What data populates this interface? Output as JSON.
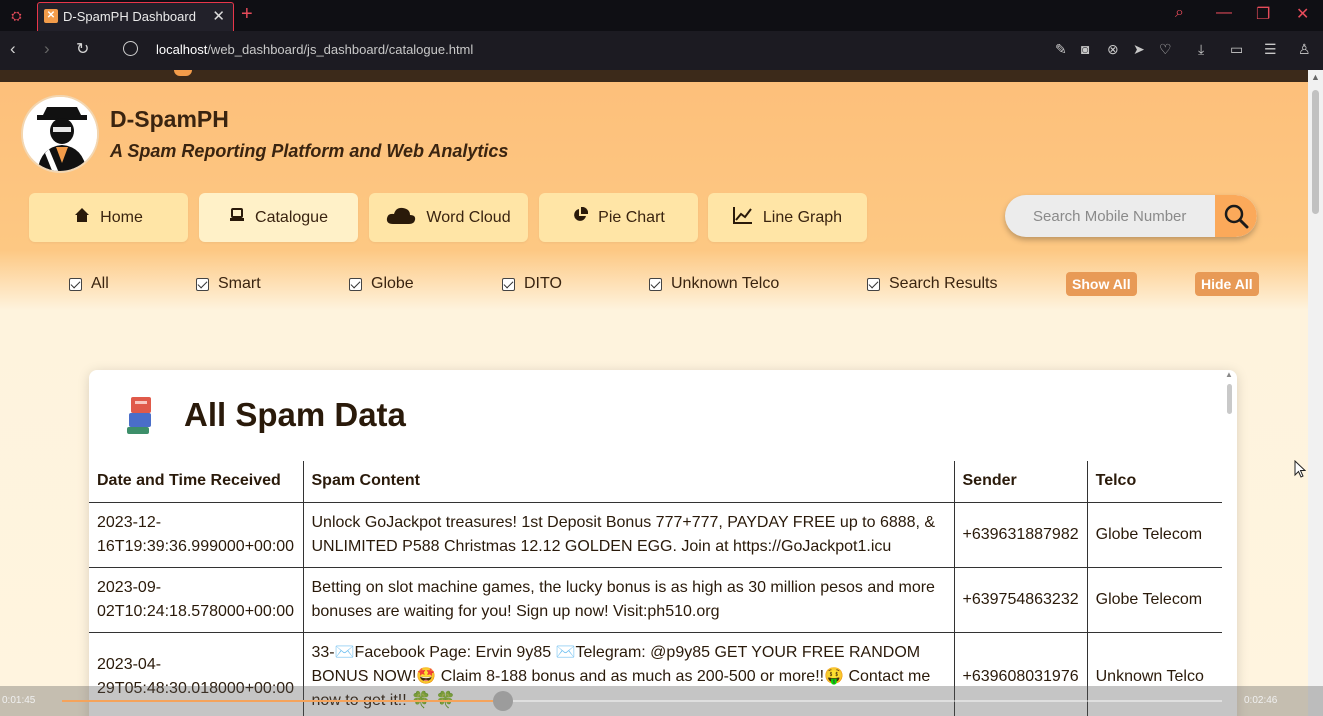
{
  "browser": {
    "tab_title": "D-SpamPH Dashboard",
    "url_host": "localhost",
    "url_path": "/web_dashboard/js_dashboard/catalogue.html",
    "accent_color": "#e8364a"
  },
  "header": {
    "title": "D-SpamPH",
    "subtitle": "A Spam Reporting Platform and Web Analytics",
    "logo_icon": "hacker-avatar-icon"
  },
  "menu": {
    "items": [
      {
        "label": "Home",
        "icon": "home-icon"
      },
      {
        "label": "Catalogue",
        "icon": "catalogue-icon",
        "active": true
      },
      {
        "label": "Word Cloud",
        "icon": "cloud-icon"
      },
      {
        "label": "Pie Chart",
        "icon": "pie-chart-icon"
      },
      {
        "label": "Line Graph",
        "icon": "line-graph-icon"
      }
    ]
  },
  "search": {
    "placeholder": "Search Mobile Number"
  },
  "filters": {
    "options": [
      {
        "label": "All",
        "checked": true
      },
      {
        "label": "Smart",
        "checked": true
      },
      {
        "label": "Globe",
        "checked": true
      },
      {
        "label": "DITO",
        "checked": true
      },
      {
        "label": "Unknown Telco",
        "checked": true
      },
      {
        "label": "Search Results",
        "checked": true
      }
    ],
    "show_all": "Show All",
    "hide_all": "Hide All"
  },
  "card": {
    "title": "All Spam Data",
    "icon": "books-icon",
    "columns": [
      "Date and Time Received",
      "Spam Content",
      "Sender",
      "Telco"
    ],
    "rows": [
      {
        "date": "2023-12-16T19:39:36.999000+00:00",
        "content": "Unlock GoJackpot treasures! 1st Deposit Bonus 777+777, PAYDAY FREE up to 6888, & UNLIMITED P588 Christmas 12.12 GOLDEN EGG. Join at https://GoJackpot1.icu",
        "sender": "+639631887982",
        "telco": "Globe Telecom"
      },
      {
        "date": "2023-09-02T10:24:18.578000+00:00",
        "content": "Betting on slot machine games, the lucky bonus is as high as 30 million pesos and more bonuses are waiting for you! Sign up now! Visit:ph510.org",
        "sender": "+639754863232",
        "telco": "Globe Telecom"
      },
      {
        "date": "2023-04-29T05:48:30.018000+00:00",
        "content": "33-✉️Facebook Page: Ervin 9y85 ✉️Telegram: @p9y85 GET YOUR FREE RANDOM BONUS NOW!🤩 Claim 8-188 bonus and as much as 200-500 or more!!🤑 Contact me now to get it!! 🍀 🍀",
        "sender": "+639608031976",
        "telco": "Unknown Telco"
      }
    ]
  },
  "video": {
    "elapsed": "0:01:45",
    "duration": "0:02:46",
    "progress": 0.38
  }
}
